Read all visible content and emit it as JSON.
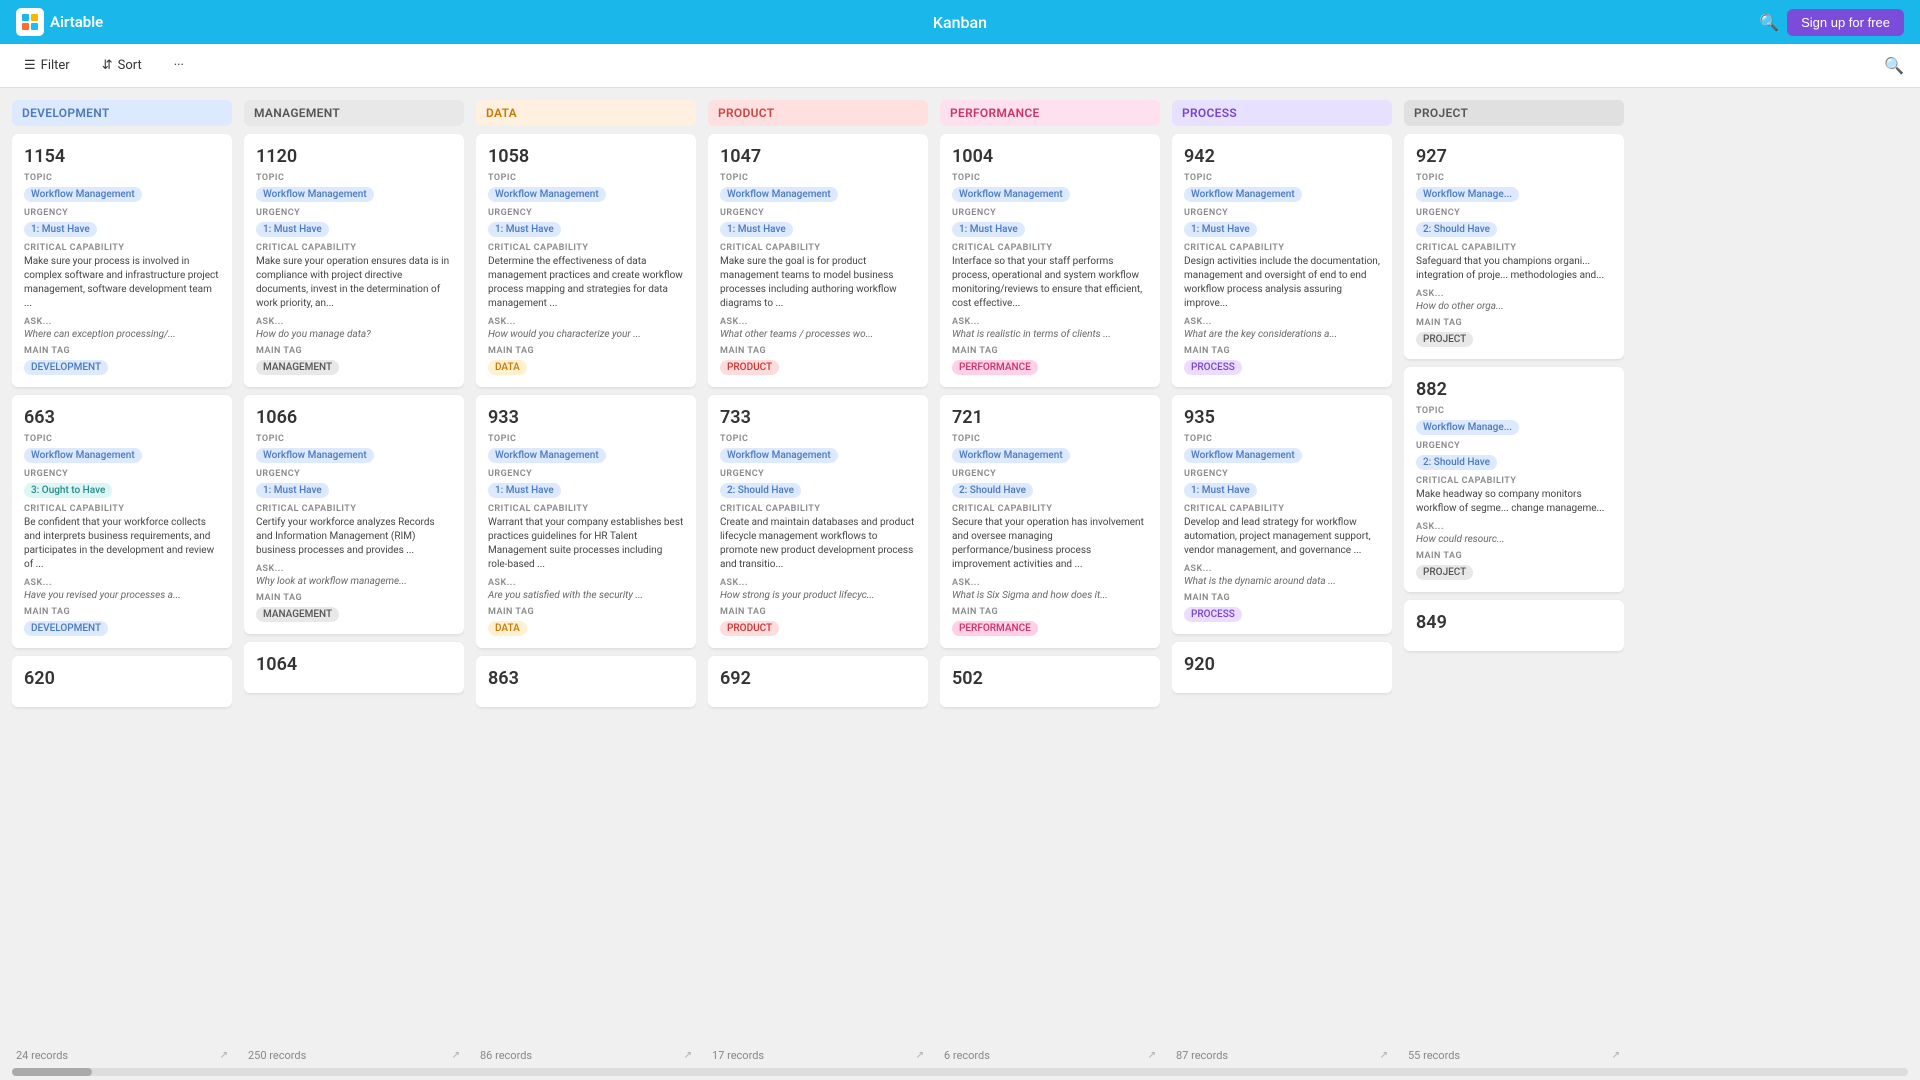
{
  "nav": {
    "logo_text": "Airtable",
    "title": "Kanban",
    "signup_label": "Sign up for free"
  },
  "toolbar": {
    "filter_label": "Filter",
    "sort_label": "Sort",
    "more_label": "···"
  },
  "columns": [
    {
      "id": "development",
      "label": "DEVELOPMENT",
      "color_class": "col-development",
      "records_count": "24 records",
      "cards": [
        {
          "id": "1154",
          "topic": "Workflow Management",
          "topic_tag": "tag-blue",
          "urgency": "1: Must Have",
          "urgency_tag": "tag-blue",
          "critical_capability": "Make sure your process is involved in complex software and infrastructure project management, software development team ...",
          "ask": "Where can exception processing/...",
          "main_tag": "DEVELOPMENT",
          "main_tag_color": "tag-blue"
        },
        {
          "id": "663",
          "topic": "Workflow Management",
          "topic_tag": "tag-blue",
          "urgency": "3: Ought to Have",
          "urgency_tag": "tag-teal",
          "critical_capability": "Be confident that your workforce collects and interprets business requirements, and participates in the development and review of ...",
          "ask": "Have you revised your processes a...",
          "main_tag": "DEVELOPMENT",
          "main_tag_color": "tag-blue"
        },
        {
          "id": "620",
          "topic": "",
          "topic_tag": "",
          "urgency": "",
          "urgency_tag": "",
          "critical_capability": "",
          "ask": "",
          "main_tag": "",
          "main_tag_color": ""
        }
      ]
    },
    {
      "id": "management",
      "label": "MANAGEMENT",
      "color_class": "col-management",
      "records_count": "250 records",
      "cards": [
        {
          "id": "1120",
          "topic": "Workflow Management",
          "topic_tag": "tag-blue",
          "urgency": "1: Must Have",
          "urgency_tag": "tag-blue",
          "critical_capability": "Make sure your operation ensures data is in compliance with project directive documents, invest in the determination of work priority, an...",
          "ask": "How do you manage data?",
          "main_tag": "MANAGEMENT",
          "main_tag_color": "tag-gray"
        },
        {
          "id": "1066",
          "topic": "Workflow Management",
          "topic_tag": "tag-blue",
          "urgency": "1: Must Have",
          "urgency_tag": "tag-blue",
          "critical_capability": "Certify your workforce analyzes Records and Information Management (RIM) business processes and provides ...",
          "ask": "Why look at workflow manageme...",
          "main_tag": "MANAGEMENT",
          "main_tag_color": "tag-gray"
        },
        {
          "id": "1064",
          "topic": "",
          "topic_tag": "",
          "urgency": "",
          "urgency_tag": "",
          "critical_capability": "",
          "ask": "",
          "main_tag": "",
          "main_tag_color": ""
        }
      ]
    },
    {
      "id": "data",
      "label": "DATA",
      "color_class": "col-data",
      "records_count": "86 records",
      "cards": [
        {
          "id": "1058",
          "topic": "Workflow Management",
          "topic_tag": "tag-blue",
          "urgency": "1: Must Have",
          "urgency_tag": "tag-blue",
          "critical_capability": "Determine the effectiveness of data management practices and create workflow process mapping and strategies for data management ...",
          "ask": "How would you characterize your ...",
          "main_tag": "DATA",
          "main_tag_color": "tag-orange"
        },
        {
          "id": "933",
          "topic": "Workflow Management",
          "topic_tag": "tag-blue",
          "urgency": "1: Must Have",
          "urgency_tag": "tag-blue",
          "critical_capability": "Warrant that your company establishes best practices guidelines for HR Talent Management suite processes including role-based ...",
          "ask": "Are you satisfied with the security ...",
          "main_tag": "DATA",
          "main_tag_color": "tag-orange"
        },
        {
          "id": "863",
          "topic": "",
          "topic_tag": "",
          "urgency": "",
          "urgency_tag": "",
          "critical_capability": "",
          "ask": "",
          "main_tag": "",
          "main_tag_color": ""
        }
      ]
    },
    {
      "id": "product",
      "label": "PRODUCT",
      "color_class": "col-product",
      "records_count": "17 records",
      "cards": [
        {
          "id": "1047",
          "topic": "Workflow Management",
          "topic_tag": "tag-blue",
          "urgency": "1: Must Have",
          "urgency_tag": "tag-blue",
          "critical_capability": "Make sure the goal is for product management teams to model business processes including authoring workflow diagrams to ...",
          "ask": "What other teams / processes wo...",
          "main_tag": "PRODUCT",
          "main_tag_color": "tag-red"
        },
        {
          "id": "733",
          "topic": "Workflow Management",
          "topic_tag": "tag-blue",
          "urgency": "2: Should Have",
          "urgency_tag": "tag-blue",
          "critical_capability": "Create and maintain databases and product lifecycle management workflows to promote new product development process and transitio...",
          "ask": "How strong is your product lifecyc...",
          "main_tag": "PRODUCT",
          "main_tag_color": "tag-red"
        },
        {
          "id": "692",
          "topic": "",
          "topic_tag": "",
          "urgency": "",
          "urgency_tag": "",
          "critical_capability": "",
          "ask": "",
          "main_tag": "",
          "main_tag_color": ""
        }
      ]
    },
    {
      "id": "performance",
      "label": "PERFORMANCE",
      "color_class": "col-performance",
      "records_count": "6 records",
      "cards": [
        {
          "id": "1004",
          "topic": "Workflow Management",
          "topic_tag": "tag-blue",
          "urgency": "1: Must Have",
          "urgency_tag": "tag-blue",
          "critical_capability": "Interface so that your staff performs process, operational and system workflow monitoring/reviews to ensure that efficient, cost effective...",
          "ask": "What is realistic in terms of clients ...",
          "main_tag": "PERFORMANCE",
          "main_tag_color": "tag-pink"
        },
        {
          "id": "721",
          "topic": "Workflow Management",
          "topic_tag": "tag-blue",
          "urgency": "2: Should Have",
          "urgency_tag": "tag-blue",
          "critical_capability": "Secure that your operation has involvement and oversee managing performance/business process improvement activities and ...",
          "ask": "What is Six Sigma and how does it...",
          "main_tag": "PERFORMANCE",
          "main_tag_color": "tag-pink"
        },
        {
          "id": "502",
          "topic": "",
          "topic_tag": "",
          "urgency": "",
          "urgency_tag": "",
          "critical_capability": "",
          "ask": "",
          "main_tag": "",
          "main_tag_color": ""
        }
      ]
    },
    {
      "id": "process",
      "label": "PROCESS",
      "color_class": "col-process",
      "records_count": "87 records",
      "cards": [
        {
          "id": "942",
          "topic": "Workflow Management",
          "topic_tag": "tag-blue",
          "urgency": "1: Must Have",
          "urgency_tag": "tag-blue",
          "critical_capability": "Design activities include the documentation, management and oversight of end to end workflow process analysis assuring improve...",
          "ask": "What are the key considerations a...",
          "main_tag": "PROCESS",
          "main_tag_color": "tag-purple"
        },
        {
          "id": "935",
          "topic": "Workflow Management",
          "topic_tag": "tag-blue",
          "urgency": "1: Must Have",
          "urgency_tag": "tag-blue",
          "critical_capability": "Develop and lead strategy for workflow automation, project management support, vendor management, and governance ...",
          "ask": "What is the dynamic around data ...",
          "main_tag": "PROCESS",
          "main_tag_color": "tag-purple"
        },
        {
          "id": "920",
          "topic": "",
          "topic_tag": "",
          "urgency": "",
          "urgency_tag": "",
          "critical_capability": "",
          "ask": "",
          "main_tag": "",
          "main_tag_color": ""
        }
      ]
    },
    {
      "id": "project",
      "label": "PROJECT",
      "color_class": "col-project",
      "records_count": "55 records",
      "cards": [
        {
          "id": "927",
          "topic": "Workflow Manage...",
          "topic_tag": "tag-blue",
          "urgency": "2: Should Have",
          "urgency_tag": "tag-blue",
          "critical_capability": "Safeguard that you champions organi... integration of proje... methodologies and...",
          "ask": "How do other orga...",
          "main_tag": "PROJECT",
          "main_tag_color": "tag-gray"
        },
        {
          "id": "882",
          "topic": "Workflow Manage...",
          "topic_tag": "tag-blue",
          "urgency": "2: Should Have",
          "urgency_tag": "tag-blue",
          "critical_capability": "Make headway so company monitors workflow of segme... change manageme...",
          "ask": "How could resourc...",
          "main_tag": "PROJECT",
          "main_tag_color": "tag-gray"
        },
        {
          "id": "849",
          "topic": "",
          "topic_tag": "",
          "urgency": "",
          "urgency_tag": "",
          "critical_capability": "",
          "ask": "",
          "main_tag": "",
          "main_tag_color": ""
        }
      ]
    }
  ]
}
